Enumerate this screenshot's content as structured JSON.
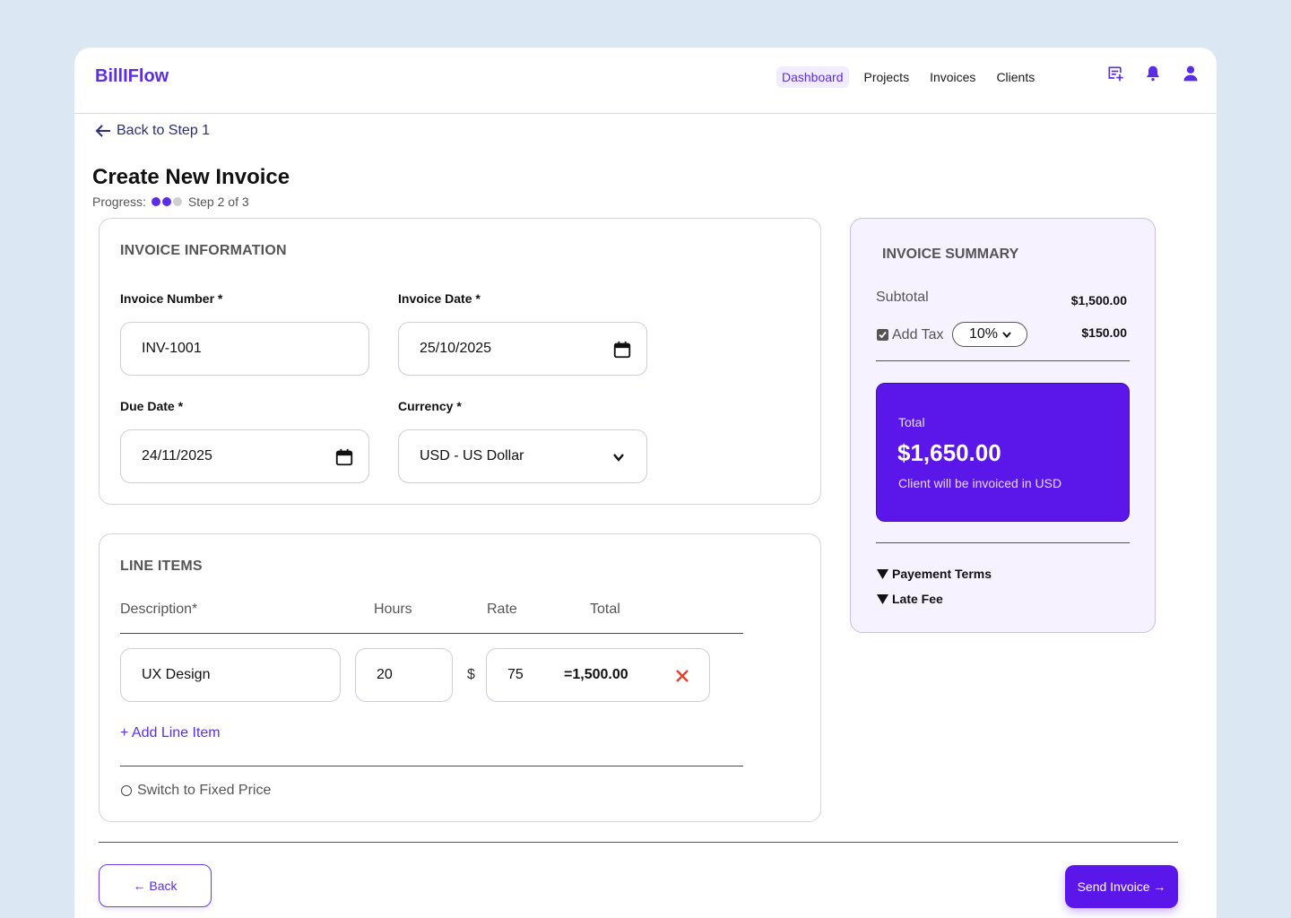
{
  "app": {
    "brand": "BillIFlow",
    "nav": [
      "Dashboard",
      "Projects",
      "Invoices",
      "Clients"
    ],
    "active_nav": "Dashboard",
    "icons": [
      "add-note-icon",
      "bell-icon",
      "user-icon"
    ],
    "accent": "#5b2ee6"
  },
  "page": {
    "back_link": "Back to Step 1",
    "title": "Create New Invoice",
    "progress_label": "Progress:",
    "progress_step": "Step 2 of 3",
    "progress_done": 2,
    "progress_total": 3
  },
  "invoice_info": {
    "title": "INVOICE INFORMATION",
    "invoice_number_label": "Invoice Number *",
    "invoice_number_value": "INV-1001",
    "invoice_date_label": "Invoice Date *",
    "invoice_date_value": "25/10/2025",
    "due_date_label": "Due Date *",
    "due_date_value": "24/11/2025",
    "currency_label": "Currency *",
    "currency_value": "USD - US Dollar"
  },
  "line_items": {
    "title": "LINE ITEMS",
    "columns": [
      "Description*",
      "Hours",
      "Rate",
      "Total"
    ],
    "rows": [
      {
        "description": "UX Design",
        "hours": "20",
        "currency_symbol": "$",
        "rate": "75",
        "total": "=1,500.00"
      }
    ],
    "add_label": "+ Add Line Item",
    "switch_label": "Switch to Fixed Price"
  },
  "summary": {
    "title": "INVOICE SUMMARY",
    "subtotal_label": "Subtotal",
    "subtotal_value": "$1,500.00",
    "tax_label": "Add Tax",
    "tax_checked": true,
    "tax_rate": "10%",
    "tax_value": "$150.00",
    "total_label": "Total",
    "total_value": "$1,650.00",
    "total_note": "Client will be invoiced in USD",
    "sections": [
      "Payement Terms",
      "Late Fee"
    ]
  },
  "footer": {
    "back_label": "← Back",
    "send_label": "Send Invoice →"
  }
}
